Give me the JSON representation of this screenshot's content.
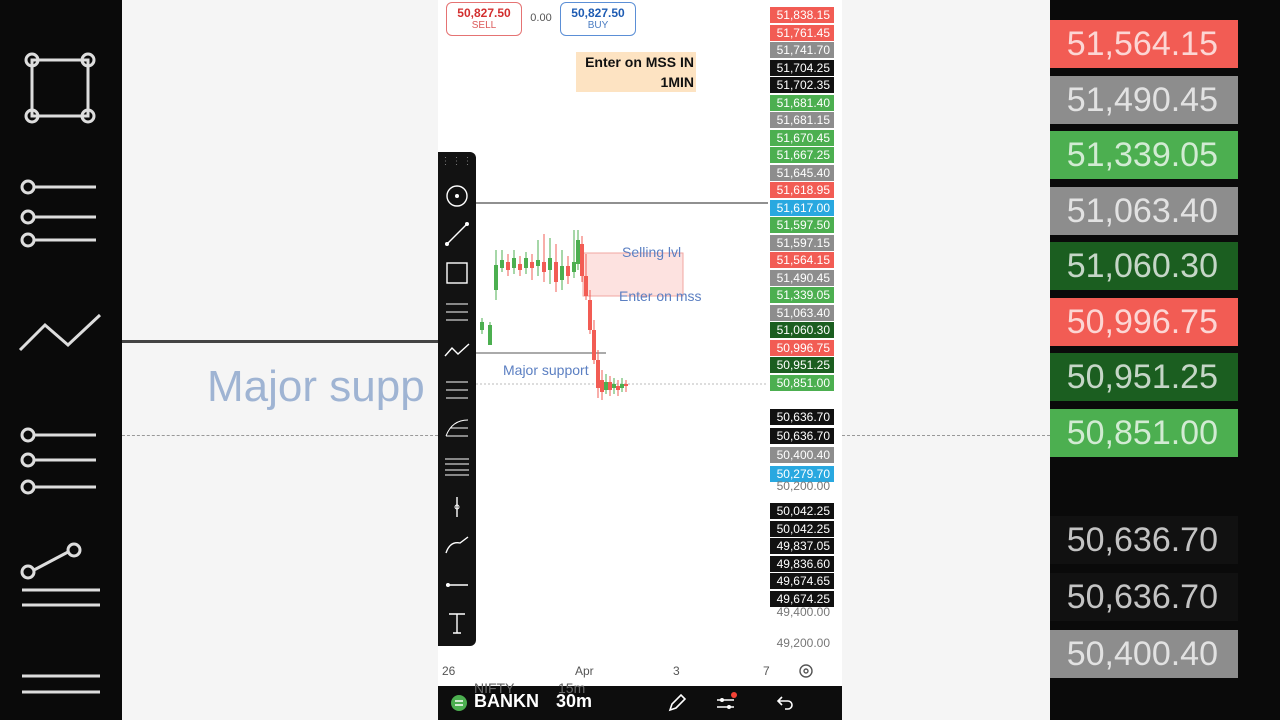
{
  "colors": {
    "red": "#f25c54",
    "green": "#4caf50",
    "dark_green": "#1b5e20",
    "gray": "#8d8d8d",
    "black": "#111111",
    "blue": "#29a8e0"
  },
  "trade": {
    "sell_price": "50,827.50",
    "sell_label": "SELL",
    "spread": "0.00",
    "buy_price": "50,827.50",
    "buy_label": "BUY"
  },
  "note": "Enter on MSS IN 1MIN",
  "annotations": {
    "selling": "Selling lvl",
    "enter": "Enter on mss",
    "support": "Major support"
  },
  "bg_left_text": "Major supp",
  "price_tags": [
    {
      "value": "51,838.15",
      "color": "red"
    },
    {
      "value": "51,761.45",
      "color": "red"
    },
    {
      "value": "51,741.70",
      "color": "gray"
    },
    {
      "value": "51,704.25",
      "color": "black"
    },
    {
      "value": "51,702.35",
      "color": "black"
    },
    {
      "value": "51,681.40",
      "color": "green"
    },
    {
      "value": "51,681.15",
      "color": "gray"
    },
    {
      "value": "51,670.45",
      "color": "green"
    },
    {
      "value": "51,667.25",
      "color": "green"
    },
    {
      "value": "51,645.40",
      "color": "gray"
    },
    {
      "value": "51,618.95",
      "color": "red"
    },
    {
      "value": "51,617.00",
      "color": "blue"
    },
    {
      "value": "51,597.50",
      "color": "green"
    },
    {
      "value": "51,597.15",
      "color": "gray"
    },
    {
      "value": "51,564.15",
      "color": "red"
    },
    {
      "value": "51,490.45",
      "color": "gray"
    },
    {
      "value": "51,339.05",
      "color": "green"
    },
    {
      "value": "51,063.40",
      "color": "gray"
    },
    {
      "value": "51,060.30",
      "color": "dark_green"
    },
    {
      "value": "50,996.75",
      "color": "red"
    },
    {
      "value": "50,951.25",
      "color": "dark_green"
    },
    {
      "value": "50,851.00",
      "color": "green"
    }
  ],
  "price_tags_low": [
    {
      "value": "50,636.70",
      "color": "black"
    },
    {
      "value": "50,636.70",
      "color": "black"
    },
    {
      "value": "50,400.40",
      "color": "gray"
    },
    {
      "value": "50,279.70",
      "color": "blue"
    }
  ],
  "price_tags_lowest": [
    {
      "value": "50,042.25",
      "color": "black"
    },
    {
      "value": "50,042.25",
      "color": "black"
    },
    {
      "value": "49,837.05",
      "color": "black"
    },
    {
      "value": "49,836.60",
      "color": "black"
    },
    {
      "value": "49,674.65",
      "color": "black"
    },
    {
      "value": "49,674.25",
      "color": "black"
    }
  ],
  "axis_plain": [
    "50,200.00",
    "49,400.00",
    "49,200.00"
  ],
  "dates": [
    "26",
    "Apr",
    "3",
    "7"
  ],
  "bg_right_tags": [
    {
      "value": "51,564.15",
      "color": "red"
    },
    {
      "value": "51,490.45",
      "color": "gray"
    },
    {
      "value": "51,339.05",
      "color": "green"
    },
    {
      "value": "51,063.40",
      "color": "gray"
    },
    {
      "value": "51,060.30",
      "color": "dark_green"
    },
    {
      "value": "50,996.75",
      "color": "red"
    },
    {
      "value": "50,951.25",
      "color": "dark_green"
    },
    {
      "value": "50,851.00",
      "color": "green"
    }
  ],
  "bg_right_low": [
    {
      "value": "50,636.70",
      "color": "black"
    },
    {
      "value": "50,636.70",
      "color": "black"
    },
    {
      "value": "50,400.40",
      "color": "gray"
    }
  ],
  "bottom": {
    "symbol": "BANKN",
    "interval": "30m",
    "ghost_symbol": "NIFTY",
    "ghost_interval": "15m"
  },
  "tools": [
    "cursor-icon",
    "trend-line-icon",
    "rectangle-icon",
    "fib-retracement-icon",
    "path-icon",
    "parallel-channel-icon",
    "pitchfork-icon",
    "horizontal-lines-icon",
    "vertical-line-icon",
    "brush-icon",
    "horizontal-ray-icon",
    "text-icon"
  ]
}
